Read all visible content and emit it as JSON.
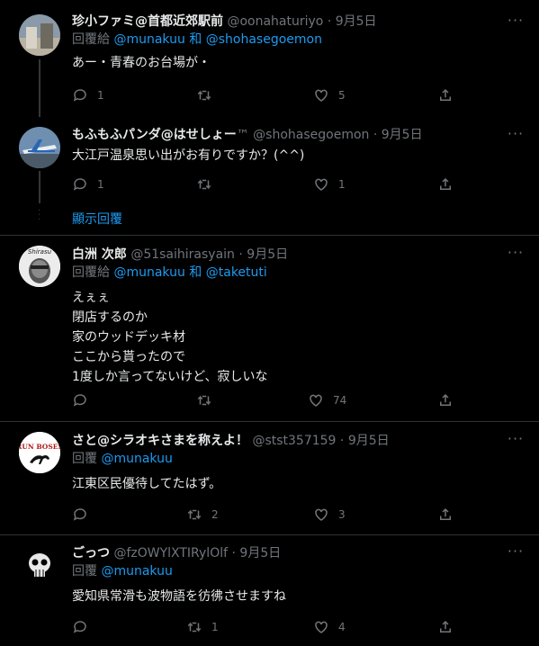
{
  "tweets": [
    {
      "name": "珍小ファミ@首都近郊駅前",
      "handle": "@oonahaturiyo",
      "date": "9月5日",
      "reply_prefix": "回覆給",
      "mentions": [
        "@munakuu",
        "和",
        "@shohasegoemon"
      ],
      "text": [
        "あー・青春のお台場が・"
      ],
      "replies": "1",
      "retweets": "",
      "likes": "5"
    },
    {
      "name": "もふもふパンダ@はせしょー",
      "badge": "™",
      "handle": "@shohasegoemon",
      "date": "9月5日",
      "text": [
        "大江戸温泉思い出がお有りですか？(^^)"
      ],
      "replies": "1",
      "retweets": "",
      "likes": "1",
      "show_more": "顯示回覆"
    },
    {
      "name": "白洲 次郎",
      "handle": "@51saihirasyain",
      "date": "9月5日",
      "reply_prefix": "回覆給",
      "mentions": [
        "@munakuu",
        "和",
        "@taketuti"
      ],
      "text": [
        "えぇぇ",
        "閉店するのか",
        "家のウッドデッキ材",
        "ここから貰ったので",
        "1度しか言ってないけど、寂しいな"
      ],
      "replies": "",
      "retweets": "",
      "likes": "74"
    },
    {
      "name": "さと@シラオキさまを称えよ！",
      "handle": "@stst357159",
      "date": "9月5日",
      "reply_prefix": "回覆",
      "mentions": [
        "@munakuu"
      ],
      "text": [
        "江東区民優待してたはず。"
      ],
      "replies": "",
      "retweets": "2",
      "likes": "3",
      "avatar_text": "RUN BOSES"
    },
    {
      "name": "ごっつ",
      "handle": "@fzOWYlXTIRylOlf",
      "date": "9月5日",
      "reply_prefix": "回覆",
      "mentions": [
        "@munakuu"
      ],
      "text": [
        "愛知県常滑も波物語を彷彿させますね"
      ],
      "replies": "",
      "retweets": "1",
      "likes": "4"
    }
  ],
  "more_glyph": "···",
  "colors": {
    "background": "#000000",
    "link": "#1d9bf0",
    "muted": "#71767b",
    "text": "#e7e9ea"
  }
}
